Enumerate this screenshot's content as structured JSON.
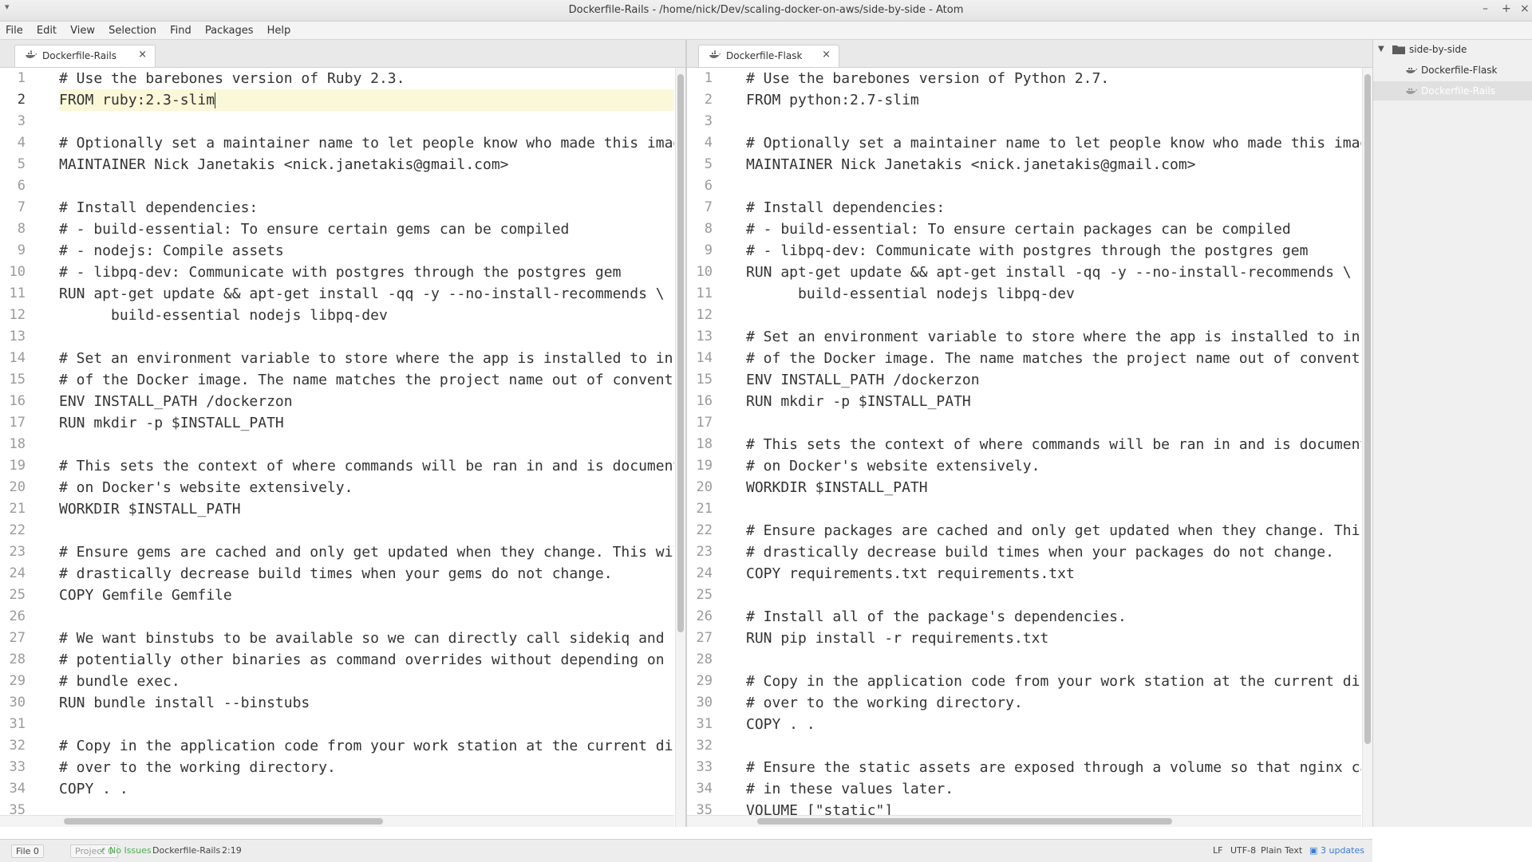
{
  "window": {
    "title": "Dockerfile-Rails - /home/nick/Dev/scaling-docker-on-aws/side-by-side - Atom",
    "controls": [
      "–",
      "+",
      "×"
    ]
  },
  "menu": [
    "File",
    "Edit",
    "View",
    "Selection",
    "Find",
    "Packages",
    "Help"
  ],
  "left_pane": {
    "tab_label": "Dockerfile-Rails",
    "cursor_line": 2,
    "lines": [
      "# Use the barebones version of Ruby 2.3.",
      "FROM ruby:2.3-slim",
      "",
      "# Optionally set a maintainer name to let people know who made this imag",
      "MAINTAINER Nick Janetakis <nick.janetakis@gmail.com>",
      "",
      "# Install dependencies:",
      "# - build-essential: To ensure certain gems can be compiled",
      "# - nodejs: Compile assets",
      "# - libpq-dev: Communicate with postgres through the postgres gem",
      "RUN apt-get update && apt-get install -qq -y --no-install-recommends \\",
      "      build-essential nodejs libpq-dev",
      "",
      "# Set an environment variable to store where the app is installed to ins",
      "# of the Docker image. The name matches the project name out of conventi",
      "ENV INSTALL_PATH /dockerzon",
      "RUN mkdir -p $INSTALL_PATH",
      "",
      "# This sets the context of where commands will be ran in and is documente",
      "# on Docker's website extensively.",
      "WORKDIR $INSTALL_PATH",
      "",
      "# Ensure gems are cached and only get updated when they change. This wil",
      "# drastically decrease build times when your gems do not change.",
      "COPY Gemfile Gemfile",
      "",
      "# We want binstubs to be available so we can directly call sidekiq and",
      "# potentially other binaries as command overrides without depending on",
      "# bundle exec.",
      "RUN bundle install --binstubs",
      "",
      "# Copy in the application code from your work station at the current dir",
      "# over to the working directory.",
      "COPY . .",
      "",
      ""
    ]
  },
  "right_pane": {
    "tab_label": "Dockerfile-Flask",
    "lines": [
      "# Use the barebones version of Python 2.7.",
      "FROM python:2.7-slim",
      "",
      "# Optionally set a maintainer name to let people know who made this imag",
      "MAINTAINER Nick Janetakis <nick.janetakis@gmail.com>",
      "",
      "# Install dependencies:",
      "# - build-essential: To ensure certain packages can be compiled",
      "# - libpq-dev: Communicate with postgres through the postgres gem",
      "RUN apt-get update && apt-get install -qq -y --no-install-recommends \\",
      "      build-essential nodejs libpq-dev",
      "",
      "# Set an environment variable to store where the app is installed to ins",
      "# of the Docker image. The name matches the project name out of conventi",
      "ENV INSTALL_PATH /dockerzon",
      "RUN mkdir -p $INSTALL_PATH",
      "",
      "# This sets the context of where commands will be ran in and is documente",
      "# on Docker's website extensively.",
      "WORKDIR $INSTALL_PATH",
      "",
      "# Ensure packages are cached and only get updated when they change. This",
      "# drastically decrease build times when your packages do not change.",
      "COPY requirements.txt requirements.txt",
      "",
      "# Install all of the package's dependencies.",
      "RUN pip install -r requirements.txt",
      "",
      "# Copy in the application code from your work station at the current dir",
      "# over to the working directory.",
      "COPY . .",
      "",
      "# Ensure the static assets are exposed through a volume so that nginx ca",
      "# in these values later.",
      "VOLUME [\"static\"]",
      ""
    ]
  },
  "tree": {
    "root": "side-by-side",
    "files": [
      "Dockerfile-Flask",
      "Dockerfile-Rails"
    ],
    "selected": "Dockerfile-Rails"
  },
  "status": {
    "file_count": "File 0",
    "project_count": "Project 0",
    "issues": "No Issues",
    "filename": "Dockerfile-Rails",
    "cursor_position": "2:19",
    "line_ending": "LF",
    "encoding": "UTF-8",
    "grammar": "Plain Text",
    "updates": "3 updates"
  },
  "colors": {
    "accent": "#3a7bd5",
    "ok": "#4bae4f",
    "cursor_line": "#fbf7d9"
  }
}
